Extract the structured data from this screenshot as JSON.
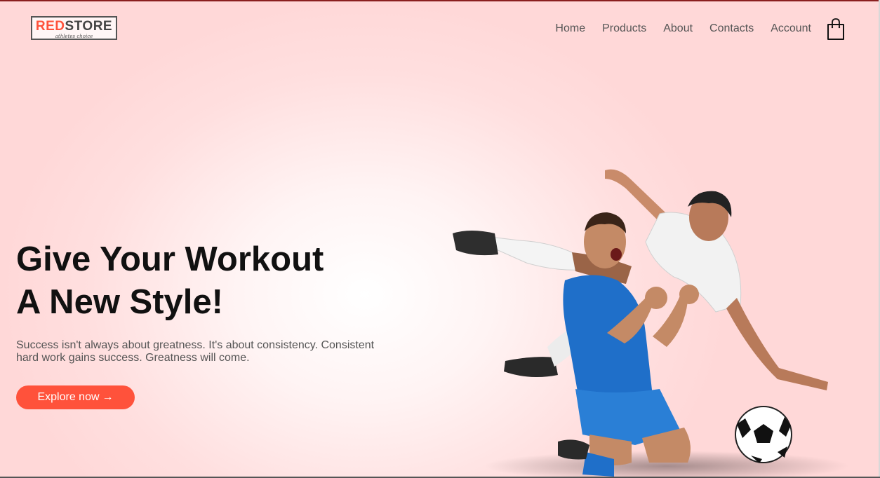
{
  "brand": {
    "name_red": "RED",
    "name_dark": "STORE",
    "tagline": "athletes choice"
  },
  "nav": {
    "items": [
      {
        "label": "Home"
      },
      {
        "label": "Products"
      },
      {
        "label": "About"
      },
      {
        "label": "Contacts"
      },
      {
        "label": "Account"
      }
    ],
    "cart_icon": "shopping-bag-icon"
  },
  "hero": {
    "title_line1": "Give Your Workout",
    "title_line2": "A New Style!",
    "subtitle_line1": "Success isn't always about greatness. It's about consistency. Consistent",
    "subtitle_line2": "hard work gains success. Greatness will come.",
    "cta_label": "Explore now",
    "cta_arrow": "→",
    "image_alt": "two soccer players celebrating with a football"
  },
  "colors": {
    "accent": "#ff523b",
    "heading": "#111111",
    "text": "#555555",
    "background": "#ffdfdf"
  }
}
